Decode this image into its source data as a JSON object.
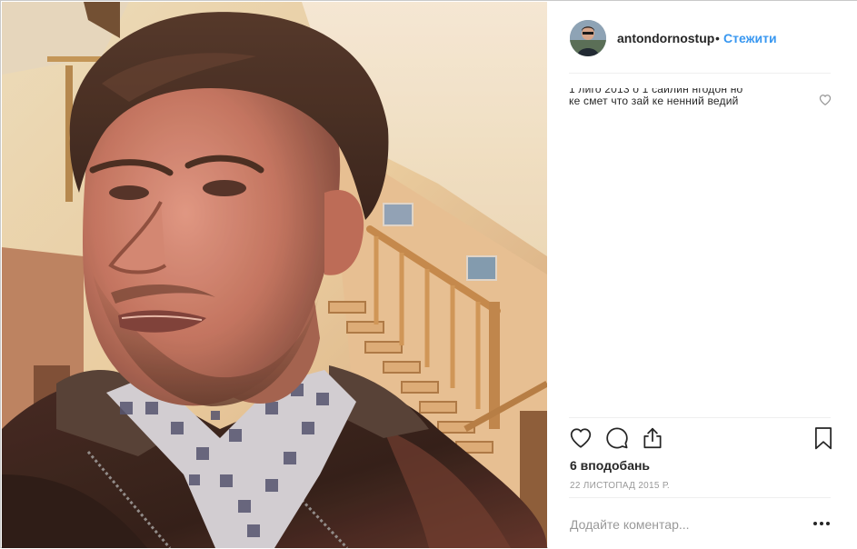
{
  "post": {
    "username": "antondornostup",
    "separator": "•",
    "follow_label": "Стежити",
    "likes_text": "6 вподобань",
    "date_text": "22 ЛИСТОПАД 2015 Р.",
    "comment_placeholder": "Додайте коментар...",
    "caption": {
      "line1": "1 лиго 2013 о 1 сайлин нгодон но",
      "line2": "ке смет что зай ке ненний ведий"
    }
  },
  "icons": {
    "like": "heart-outline-icon",
    "comment": "speech-bubble-icon",
    "share": "share-arrow-icon",
    "save": "bookmark-icon",
    "more": "more-options-icon",
    "caption_like": "small-heart-icon"
  },
  "colors": {
    "accent": "#3897f0",
    "text": "#262626",
    "muted": "#999999",
    "divider": "#efefef"
  }
}
